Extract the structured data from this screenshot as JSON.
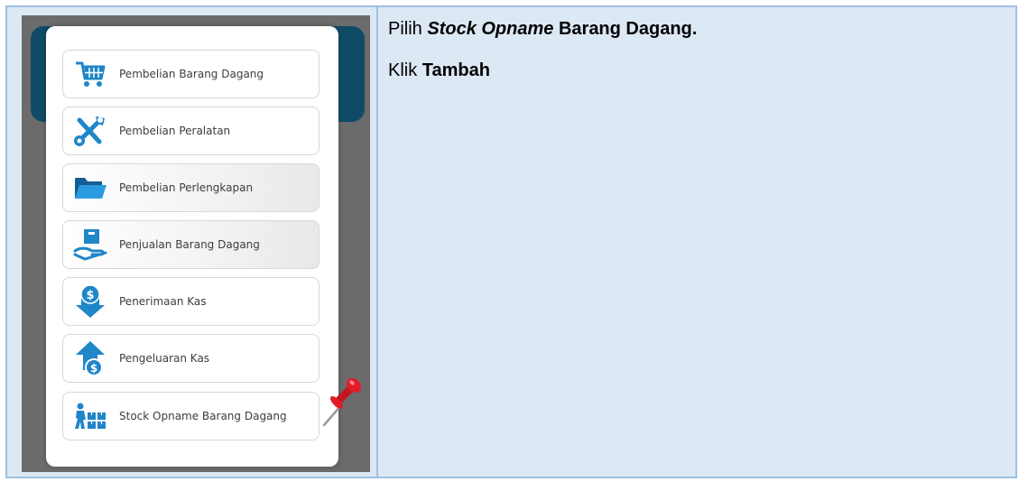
{
  "menu": {
    "items": [
      {
        "label": "Pembelian Barang Dagang",
        "icon": "cart-icon"
      },
      {
        "label": "Pembelian Peralatan",
        "icon": "tools-icon"
      },
      {
        "label": "Pembelian Perlengkapan",
        "icon": "folder-icon"
      },
      {
        "label": "Penjualan Barang Dagang",
        "icon": "hand-box-icon"
      },
      {
        "label": "Penerimaan Kas",
        "icon": "cash-in-icon"
      },
      {
        "label": "Pengeluaran Kas",
        "icon": "cash-out-icon"
      },
      {
        "label": "Stock Opname Barang Dagang",
        "icon": "stock-opname-icon"
      }
    ]
  },
  "instructions": {
    "line1_prefix": "Pilih ",
    "line1_italic": "Stock Opname",
    "line1_bold": " Barang Dagang.",
    "line2_prefix": "Klik ",
    "line2_bold": "Tambah"
  },
  "colors": {
    "table_border": "#9fc0e2",
    "table_background": "#dde8f5",
    "icon_blue": "#1f86c8",
    "pin_red": "#e11d2a"
  }
}
